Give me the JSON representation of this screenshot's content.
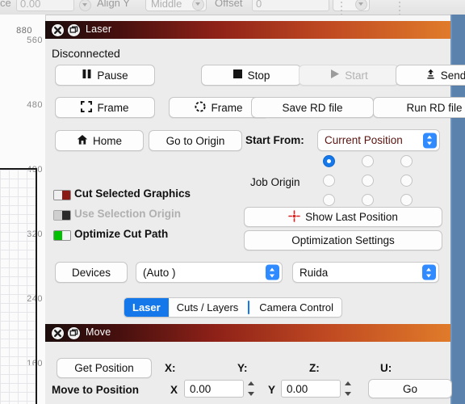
{
  "top_toolbar": {
    "space_value": "0.00",
    "align_y_label": "Align Y",
    "align_y_value": "Middle",
    "offset_label": "Offset",
    "offset_value": "0"
  },
  "vertical_ruler": {
    "ticks": [
      "880",
      "560",
      "480",
      "400",
      "320",
      "240",
      "160"
    ]
  },
  "laser_panel": {
    "title": "Laser",
    "status": "Disconnected",
    "buttons": {
      "pause": "Pause",
      "stop": "Stop",
      "start": "Start",
      "send": "Send",
      "frame_square": "Frame",
      "frame_round": "Frame",
      "save_rd": "Save RD file",
      "run_rd": "Run RD file",
      "home": "Home",
      "go_to_origin": "Go to Origin",
      "show_last_position": "Show Last Position",
      "optimization_settings": "Optimization Settings",
      "devices": "Devices"
    },
    "start_from_label": "Start From:",
    "start_from_value": "Current Position",
    "job_origin_label": "Job Origin",
    "job_origin_selected": "top-left",
    "options": [
      {
        "label": "Cut Selected Graphics",
        "state": "off",
        "disabled": false
      },
      {
        "label": "Use Selection Origin",
        "state": "off",
        "disabled": true
      },
      {
        "label": "Optimize Cut Path",
        "state": "on",
        "disabled": false
      }
    ],
    "device_profile": "(Auto )",
    "device_brand": "Ruida",
    "tabs": [
      {
        "label": "Laser",
        "active": true
      },
      {
        "label": "Cuts / Layers",
        "active": false
      },
      {
        "label": "Camera Control",
        "active": false
      }
    ]
  },
  "move_panel": {
    "title": "Move",
    "get_position_label": "Get Position",
    "axis_labels": {
      "x": "X:",
      "y": "Y:",
      "z": "Z:",
      "u": "U:"
    },
    "move_to_position_label": "Move to Position",
    "x_prefix": "X",
    "x_value": "0.00",
    "y_prefix": "Y",
    "y_value": "0.00",
    "go_label": "Go"
  },
  "colors": {
    "accent_blue": "#1477ea",
    "title_gradient_start": "#1b0d0c",
    "title_gradient_end": "#e07b2a",
    "maroon_text": "#5a1410",
    "toggle_on": "#00c000",
    "toggle_off": "#8b1a15"
  }
}
